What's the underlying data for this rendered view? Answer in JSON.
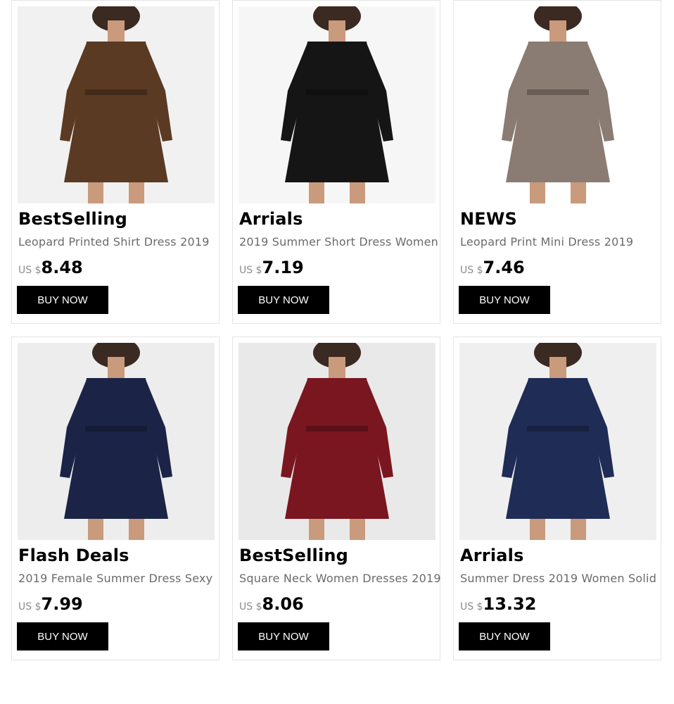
{
  "currency": "US $",
  "button_label": "BUY NOW",
  "products": [
    {
      "tag": "BestSelling",
      "name": "Leopard Printed Shirt Dress 2019",
      "price": "8.48",
      "image": "leopard-patchwork-shirt-dress",
      "dress_color": "#5a3a22",
      "bg": "#f1f1f1"
    },
    {
      "tag": "Arrials",
      "name": "2019 Summer Short Dress Women",
      "price": "7.19",
      "image": "black-polka-dot-dress",
      "dress_color": "#151515",
      "bg": "#f6f6f6"
    },
    {
      "tag": "NEWS",
      "name": "Leopard Print Mini Dress 2019",
      "price": "7.46",
      "image": "leopard-mini-dress",
      "dress_color": "#8a7c72",
      "bg": "#ffffff"
    },
    {
      "tag": "Flash Deals",
      "name": "2019 Female Summer Dress Sexy",
      "price": "7.99",
      "image": "navy-polka-dot-dress",
      "dress_color": "#1b2447",
      "bg": "#ededed"
    },
    {
      "tag": "BestSelling",
      "name": "Square Neck Women Dresses 2019",
      "price": "8.06",
      "image": "burgundy-square-neck-dress",
      "dress_color": "#7a1620",
      "bg": "#e9e9e9"
    },
    {
      "tag": "Arrials",
      "name": "Summer Dress 2019 Women Solid",
      "price": "13.32",
      "image": "navy-button-wrap-dress",
      "dress_color": "#1f2c55",
      "bg": "#efefef"
    }
  ]
}
